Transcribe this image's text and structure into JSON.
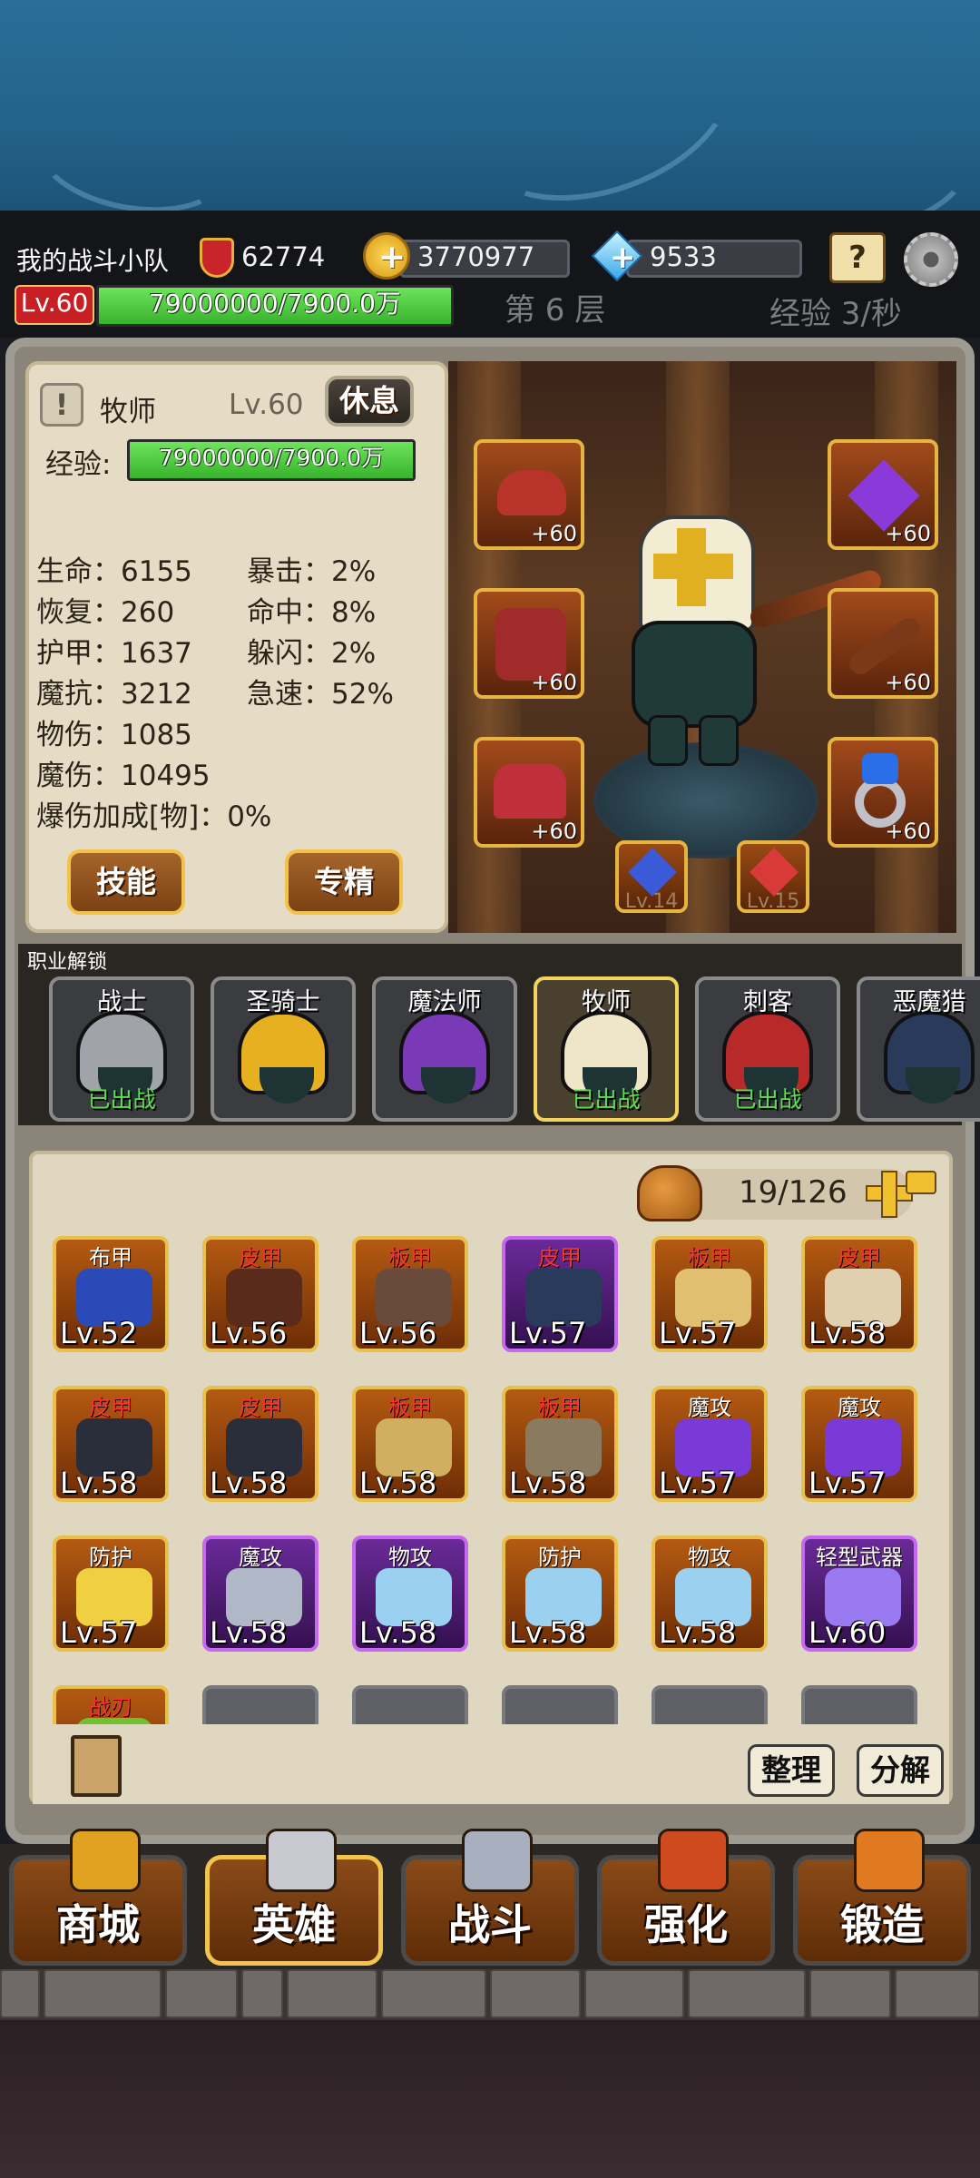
{
  "header": {
    "team_name": "我的战斗小队",
    "power": "62774",
    "gold": "3770977",
    "diamonds": "9533",
    "player_level": "Lv.60",
    "player_exp": "79000000/7900.0万",
    "player_exp_fraction": 1.0,
    "floor": "第 6 层",
    "exp_rate": "经验 3/秒",
    "icons": [
      "shield-sword-icon",
      "gold-coin-plus-icon",
      "diamond-plus-icon",
      "quest-book-icon",
      "settings-gear-icon"
    ]
  },
  "hero": {
    "class_name": "牧师",
    "level": "Lv.60",
    "rest_label": "休息",
    "exp_label": "经验:",
    "exp_value": "79000000/7900.0万",
    "exp_fraction": 1.0,
    "stats_left": [
      "生命：6155",
      "恢复：260",
      "护甲：1637",
      "魔抗：3212",
      "物伤：1085",
      "魔伤：10495",
      "爆伤加成[物]：0%"
    ],
    "stats_right": [
      "暴击：2%",
      "命中：8%",
      "躲闪：2%",
      "急速：52%"
    ],
    "skill_label": "技能",
    "spec_label": "专精",
    "equip_slots": [
      {
        "slot": "hat",
        "plus": "+60",
        "color": "#b8342a"
      },
      {
        "slot": "amulet",
        "plus": "+60",
        "color": "#8a3ad8"
      },
      {
        "slot": "armor",
        "plus": "+60",
        "color": "#a12b2b"
      },
      {
        "slot": "weapon",
        "plus": "+60",
        "color": "#7a3a1a"
      },
      {
        "slot": "boots",
        "plus": "+60",
        "color": "#c0303a"
      },
      {
        "slot": "ring",
        "plus": "+60",
        "color": "#2a6ee8"
      }
    ],
    "gems": [
      {
        "level": "Lv.14",
        "color": "#3a5ad8"
      },
      {
        "level": "Lv.15",
        "color": "#d83a3a"
      }
    ]
  },
  "classes": {
    "section_label": "职业解锁",
    "items": [
      {
        "name": "战士",
        "status": "已出战",
        "selected": false,
        "color": "#a0a4aa"
      },
      {
        "name": "圣骑士",
        "status": "",
        "selected": false,
        "color": "#e6b020"
      },
      {
        "name": "魔法师",
        "status": "",
        "selected": false,
        "color": "#7a3ab8"
      },
      {
        "name": "牧师",
        "status": "已出战",
        "selected": true,
        "color": "#efe6c8"
      },
      {
        "name": "刺客",
        "status": "已出战",
        "selected": false,
        "color": "#b82a2a"
      },
      {
        "name": "恶魔猎",
        "status": "",
        "selected": false,
        "color": "#2a3a5a"
      }
    ]
  },
  "inventory": {
    "count": "19/126",
    "sort_label": "整理",
    "disassemble_label": "分解",
    "items": [
      {
        "type": "布甲",
        "type_color": "#ffffff",
        "level": "Lv.52",
        "rarity": "orange",
        "art": "#2a4ab8"
      },
      {
        "type": "皮甲",
        "type_color": "#ff3030",
        "level": "Lv.56",
        "rarity": "orange",
        "art": "#5a2a1a"
      },
      {
        "type": "板甲",
        "type_color": "#ff3030",
        "level": "Lv.56",
        "rarity": "orange",
        "art": "#6a4a3a"
      },
      {
        "type": "皮甲",
        "type_color": "#ff3030",
        "level": "Lv.57",
        "rarity": "purple",
        "art": "#2a3a5a"
      },
      {
        "type": "板甲",
        "type_color": "#ff3030",
        "level": "Lv.57",
        "rarity": "orange",
        "art": "#e0c070"
      },
      {
        "type": "皮甲",
        "type_color": "#ff3030",
        "level": "Lv.58",
        "rarity": "orange",
        "art": "#e0d0b0"
      },
      {
        "type": "皮甲",
        "type_color": "#ff3030",
        "level": "Lv.58",
        "rarity": "orange",
        "art": "#2a2e3a"
      },
      {
        "type": "皮甲",
        "type_color": "#ff3030",
        "level": "Lv.58",
        "rarity": "orange",
        "art": "#2a2e3a"
      },
      {
        "type": "板甲",
        "type_color": "#ff3030",
        "level": "Lv.58",
        "rarity": "orange",
        "art": "#d0b060"
      },
      {
        "type": "板甲",
        "type_color": "#ff3030",
        "level": "Lv.58",
        "rarity": "orange",
        "art": "#8a7a60"
      },
      {
        "type": "魔攻",
        "type_color": "#ffffff",
        "level": "Lv.57",
        "rarity": "orange",
        "art": "#7a3ad8"
      },
      {
        "type": "魔攻",
        "type_color": "#ffffff",
        "level": "Lv.57",
        "rarity": "orange",
        "art": "#7a3ad8"
      },
      {
        "type": "防护",
        "type_color": "#ffffff",
        "level": "Lv.57",
        "rarity": "orange",
        "art": "#f0d040"
      },
      {
        "type": "魔攻",
        "type_color": "#ffffff",
        "level": "Lv.58",
        "rarity": "purple",
        "art": "#b0b8c8"
      },
      {
        "type": "物攻",
        "type_color": "#ffffff",
        "level": "Lv.58",
        "rarity": "purple",
        "art": "#9ad0f0"
      },
      {
        "type": "防护",
        "type_color": "#ffffff",
        "level": "Lv.58",
        "rarity": "orange",
        "art": "#9ad0f0"
      },
      {
        "type": "物攻",
        "type_color": "#ffffff",
        "level": "Lv.58",
        "rarity": "orange",
        "art": "#9ad0f0"
      },
      {
        "type": "轻型武器",
        "type_color": "#ffffff",
        "level": "Lv.60",
        "rarity": "purple",
        "art": "#9a7af0"
      },
      {
        "type": "战刃",
        "type_color": "#ff3030",
        "level": "",
        "rarity": "orange",
        "art": "#70c030"
      }
    ]
  },
  "nav": {
    "items": [
      {
        "label": "商城",
        "icon": "treasure-chest-icon",
        "active": false
      },
      {
        "label": "英雄",
        "icon": "horned-helmet-icon",
        "active": true
      },
      {
        "label": "战斗",
        "icon": "crossed-swords-icon",
        "active": false
      },
      {
        "label": "强化",
        "icon": "anvil-hammer-icon",
        "active": false
      },
      {
        "label": "锻造",
        "icon": "forge-crystal-icon",
        "active": false
      }
    ]
  }
}
